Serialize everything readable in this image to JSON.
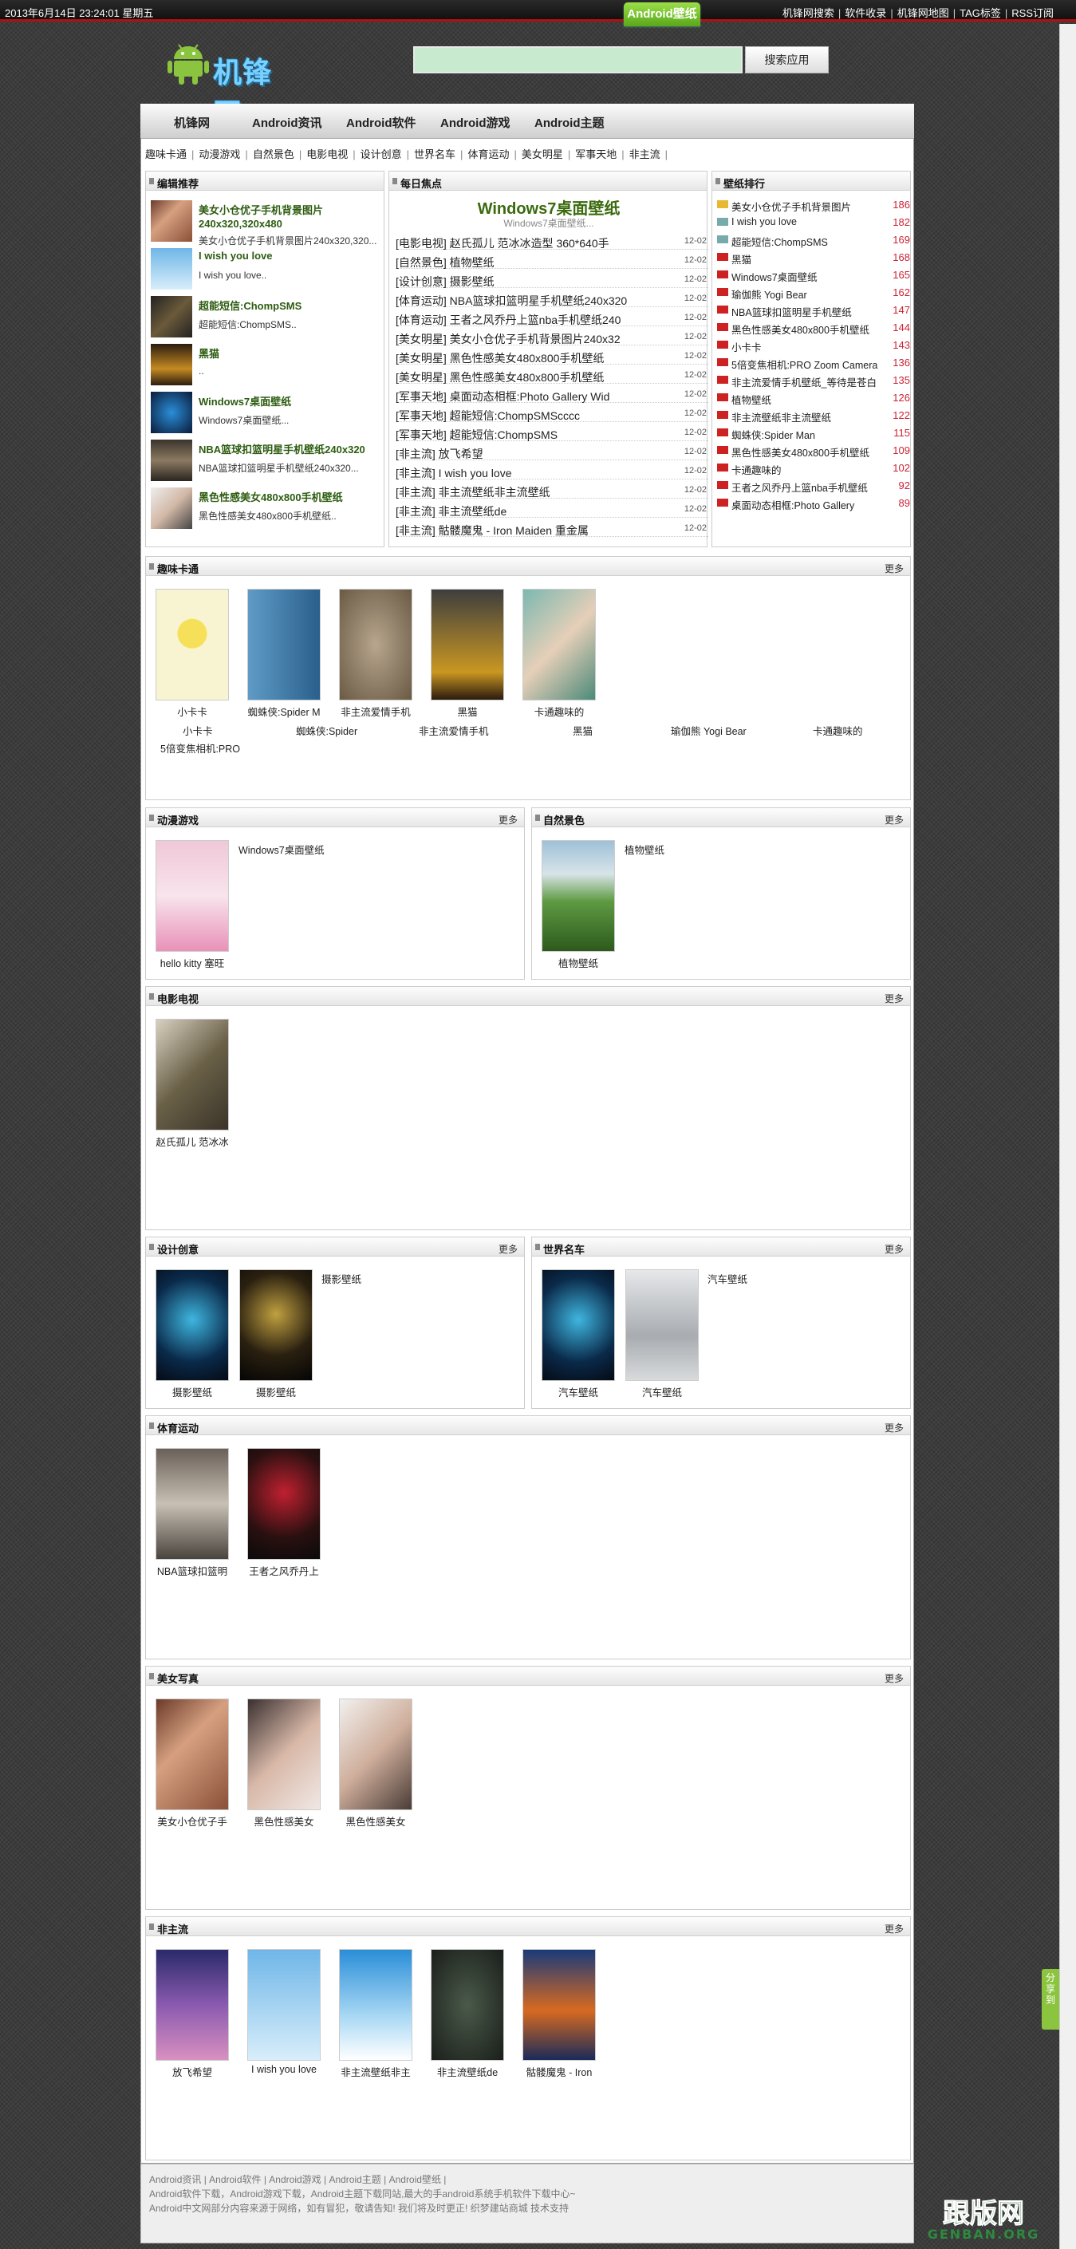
{
  "topbar": {
    "date": "2013年6月14日 23:24:01 星期五",
    "links": [
      "机锋网搜索",
      "软件收录",
      "机锋网地图",
      "TAG标签",
      "RSS订阅"
    ]
  },
  "logo": {
    "text": "机锋网"
  },
  "search": {
    "value": "",
    "button": "搜索应用"
  },
  "nav": {
    "items": [
      "机锋网",
      "Android资讯",
      "Android软件",
      "Android游戏",
      "Android主题"
    ],
    "active": "Android壁纸"
  },
  "subnav": [
    "趣味卡通",
    "动漫游戏",
    "自然景色",
    "电影电视",
    "设计创意",
    "世界名车",
    "体育运动",
    "美女明星",
    "军事天地",
    "非主流"
  ],
  "editor": {
    "title": "编辑推荐",
    "items": [
      {
        "title": "美女小仓优子手机背景图片",
        "title2": "240x320,320x480",
        "desc": "美女小仓优子手机背景图片240x320,320..."
      },
      {
        "title": "I wish you love",
        "desc": "I wish you love.."
      },
      {
        "title": "超能短信:ChompSMS",
        "desc": "超能短信:ChompSMS.."
      },
      {
        "title": "黑猫",
        "desc": ".."
      },
      {
        "title": "Windows7桌面壁纸",
        "desc": "Windows7桌面壁纸..."
      },
      {
        "title": "NBA篮球扣篮明星手机壁纸240x320",
        "desc": "NBA篮球扣篮明星手机壁纸240x320..."
      },
      {
        "title": "黑色性感美女480x800手机壁纸",
        "desc": "黑色性感美女480x800手机壁纸.."
      }
    ]
  },
  "focus": {
    "title": "每日焦点",
    "headline": "Windows7桌面壁纸",
    "sub": "Windows7桌面壁纸...",
    "items": [
      {
        "t": "[电影电视] 赵氏孤儿 范冰冰造型 360*640手",
        "d": "12-02"
      },
      {
        "t": "[自然景色] 植物壁纸",
        "d": "12-02"
      },
      {
        "t": "[设计创意] 摄影壁纸",
        "d": "12-02"
      },
      {
        "t": "[体育运动] NBA篮球扣篮明星手机壁纸240x320",
        "d": "12-02"
      },
      {
        "t": "[体育运动] 王者之风乔丹上篮nba手机壁纸240",
        "d": "12-02"
      },
      {
        "t": "[美女明星] 美女小仓优子手机背景图片240x32",
        "d": "12-02"
      },
      {
        "t": "[美女明星] 黑色性感美女480x800手机壁纸",
        "d": "12-02"
      },
      {
        "t": "[美女明星] 黑色性感美女480x800手机壁纸",
        "d": "12-02"
      },
      {
        "t": "[军事天地] 桌面动态相框:Photo Gallery Wid",
        "d": "12-02"
      },
      {
        "t": "[军事天地] 超能短信:ChompSMScccc",
        "d": "12-02"
      },
      {
        "t": "[军事天地] 超能短信:ChompSMS",
        "d": "12-02"
      },
      {
        "t": "[非主流] 放飞希望",
        "d": "12-02"
      },
      {
        "t": "[非主流] I wish you love",
        "d": "12-02"
      },
      {
        "t": "[非主流] 非主流壁纸非主流壁纸",
        "d": "12-02"
      },
      {
        "t": "[非主流] 非主流壁纸de",
        "d": "12-02"
      },
      {
        "t": "[非主流] 骷髅魔鬼 - Iron Maiden 重金属",
        "d": "12-02"
      }
    ]
  },
  "rank": {
    "title": "壁纸排行",
    "items": [
      {
        "n": "美女小仓优子手机背景图片",
        "c": "186"
      },
      {
        "n": "I wish you love",
        "c": "182"
      },
      {
        "n": "超能短信:ChompSMS",
        "c": "169"
      },
      {
        "n": "黑猫",
        "c": "168"
      },
      {
        "n": "Windows7桌面壁纸",
        "c": "165"
      },
      {
        "n": "瑜伽熊 Yogi Bear",
        "c": "162"
      },
      {
        "n": "NBA篮球扣篮明星手机壁纸",
        "c": "147"
      },
      {
        "n": "黑色性感美女480x800手机壁纸",
        "c": "144"
      },
      {
        "n": "小卡卡",
        "c": "143"
      },
      {
        "n": "5倍变焦相机:PRO Zoom Camera",
        "c": "136"
      },
      {
        "n": "非主流爱情手机壁纸_等待是苍白",
        "c": "135"
      },
      {
        "n": "植物壁纸",
        "c": "126"
      },
      {
        "n": "非主流壁纸非主流壁纸",
        "c": "122"
      },
      {
        "n": "蜘蛛侠:Spider Man",
        "c": "115"
      },
      {
        "n": "黑色性感美女480x800手机壁纸",
        "c": "109"
      },
      {
        "n": "卡通趣味的",
        "c": "102"
      },
      {
        "n": "王者之风乔丹上篮nba手机壁纸",
        "c": "92"
      },
      {
        "n": "桌面动态相框:Photo Gallery",
        "c": "89"
      }
    ]
  },
  "sections": {
    "cartoon": {
      "title": "趣味卡通",
      "more": "更多",
      "caps": [
        "小卡卡",
        "蜘蛛侠:Spider M",
        "非主流爱情手机",
        "黑猫",
        "卡通趣味的"
      ],
      "row2": [
        "小卡卡",
        "蜘蛛侠:Spider",
        "非主流爱情手机",
        "黑猫",
        "瑜伽熊  Yogi Bear",
        "卡通趣味的"
      ],
      "row3": "5倍变焦相机:PRO"
    },
    "anime": {
      "title": "动漫游戏",
      "more": "更多",
      "caps": [
        "hello kitty 塞旺"
      ],
      "free": "Windows7桌面壁纸"
    },
    "nature": {
      "title": "自然景色",
      "more": "更多",
      "caps": [
        "植物壁纸"
      ],
      "free": "植物壁纸"
    },
    "movie": {
      "title": "电影电视",
      "more": "更多",
      "caps": [
        "赵氏孤儿 范冰冰"
      ]
    },
    "design": {
      "title": "设计创意",
      "more": "更多",
      "caps": [
        "摄影壁纸",
        "摄影壁纸"
      ],
      "free": "摄影壁纸"
    },
    "cars": {
      "title": "世界名车",
      "more": "更多",
      "caps": [
        "汽车壁纸",
        "汽车壁纸"
      ],
      "free": "汽车壁纸"
    },
    "sports": {
      "title": "体育运动",
      "more": "更多",
      "caps": [
        "NBA篮球扣篮明",
        "王者之风乔丹上"
      ]
    },
    "beauty": {
      "title": "美女写真",
      "more": "更多",
      "caps": [
        "美女小仓优子手",
        "黑色性感美女",
        "黑色性感美女"
      ]
    },
    "indie": {
      "title": "非主流",
      "more": "更多",
      "caps": [
        "放飞希望",
        "I wish you love",
        "非主流壁纸非主",
        "非主流壁纸de",
        "骷髅魔鬼 - Iron"
      ]
    }
  },
  "footer": {
    "lines": [
      "Android资讯 | Android软件 | Android游戏 | Android主题 | Android壁纸 |",
      "Android软件下载，Android游戏下载，Android主题下载同站,最大的手android系统手机软件下载中心~",
      "Android中文网部分内容来源于网络，如有冒犯，敬请告知! 我们将及时更正!   织梦建站商城  技术支持"
    ]
  },
  "share": "分享到",
  "watermark": {
    "main": "跟版网",
    "sub": "GENBAN.ORG"
  }
}
